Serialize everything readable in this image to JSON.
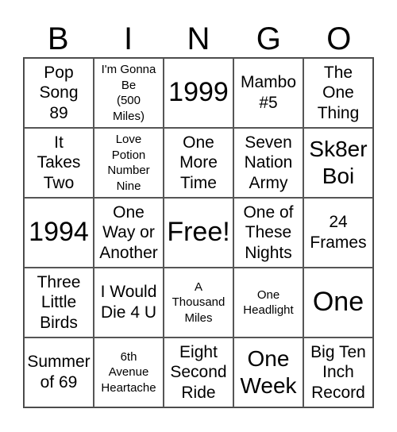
{
  "header": [
    "B",
    "I",
    "N",
    "G",
    "O"
  ],
  "cells": [
    "Pop\nSong\n89",
    "I'm Gonna\nBe\n(500\nMiles)",
    "1999",
    "Mambo\n#5",
    "The\nOne\nThing",
    "It\nTakes\nTwo",
    "Love\nPotion\nNumber\nNine",
    "One\nMore\nTime",
    "Seven\nNation\nArmy",
    "Sk8er\nBoi",
    "1994",
    "One\nWay or\nAnother",
    "Free!",
    "One of\nThese\nNights",
    "24\nFrames",
    "Three\nLittle\nBirds",
    "I Would\nDie 4 U",
    "A\nThousand\nMiles",
    "One\nHeadlight",
    "One",
    "Summer\nof 69",
    "6th\nAvenue\nHeartache",
    "Eight\nSecond\nRide",
    "One\nWeek",
    "Big Ten\nInch\nRecord"
  ]
}
